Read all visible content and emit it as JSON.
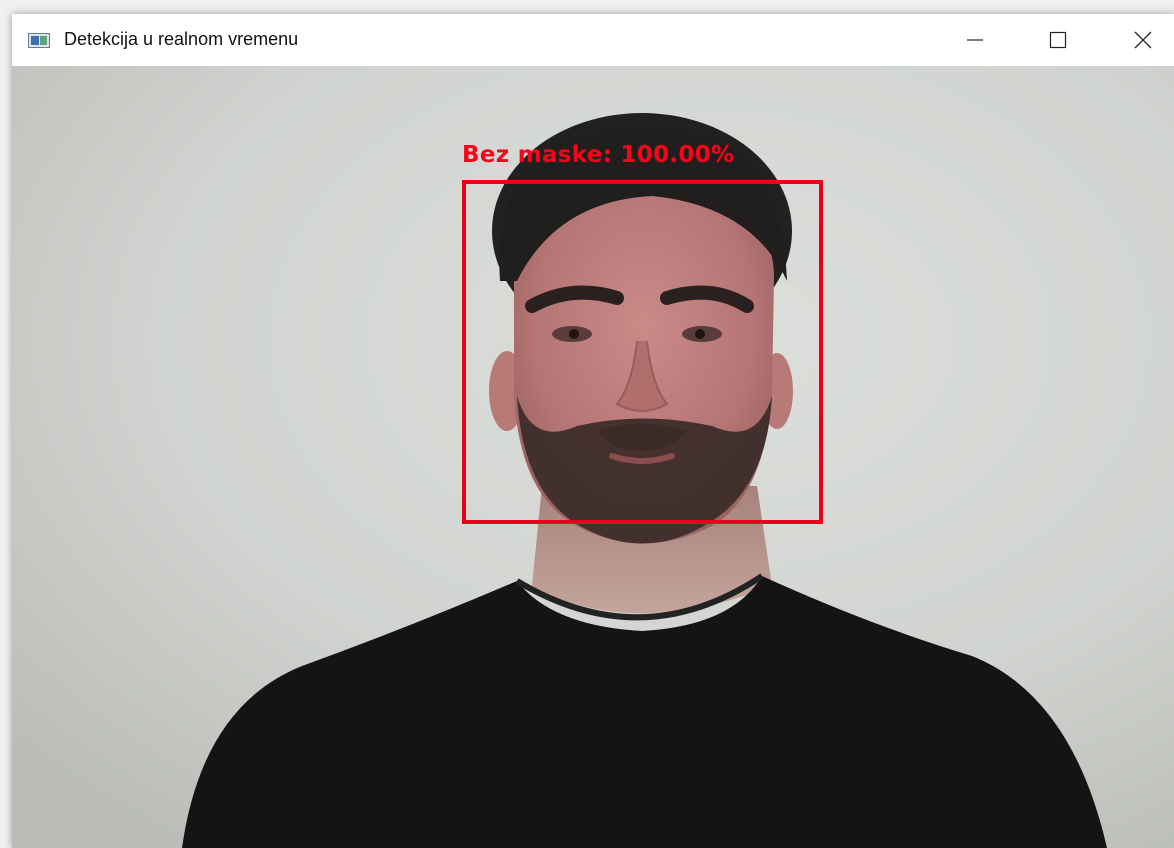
{
  "window": {
    "title": "Detekcija u realnom vremenu",
    "icons": {
      "app": "app-window-icon",
      "minimize": "minimize-icon",
      "maximize": "maximize-icon",
      "close": "close-icon"
    }
  },
  "detection": {
    "label": "Bez maske: 100.00%",
    "color": "#ff0018"
  }
}
